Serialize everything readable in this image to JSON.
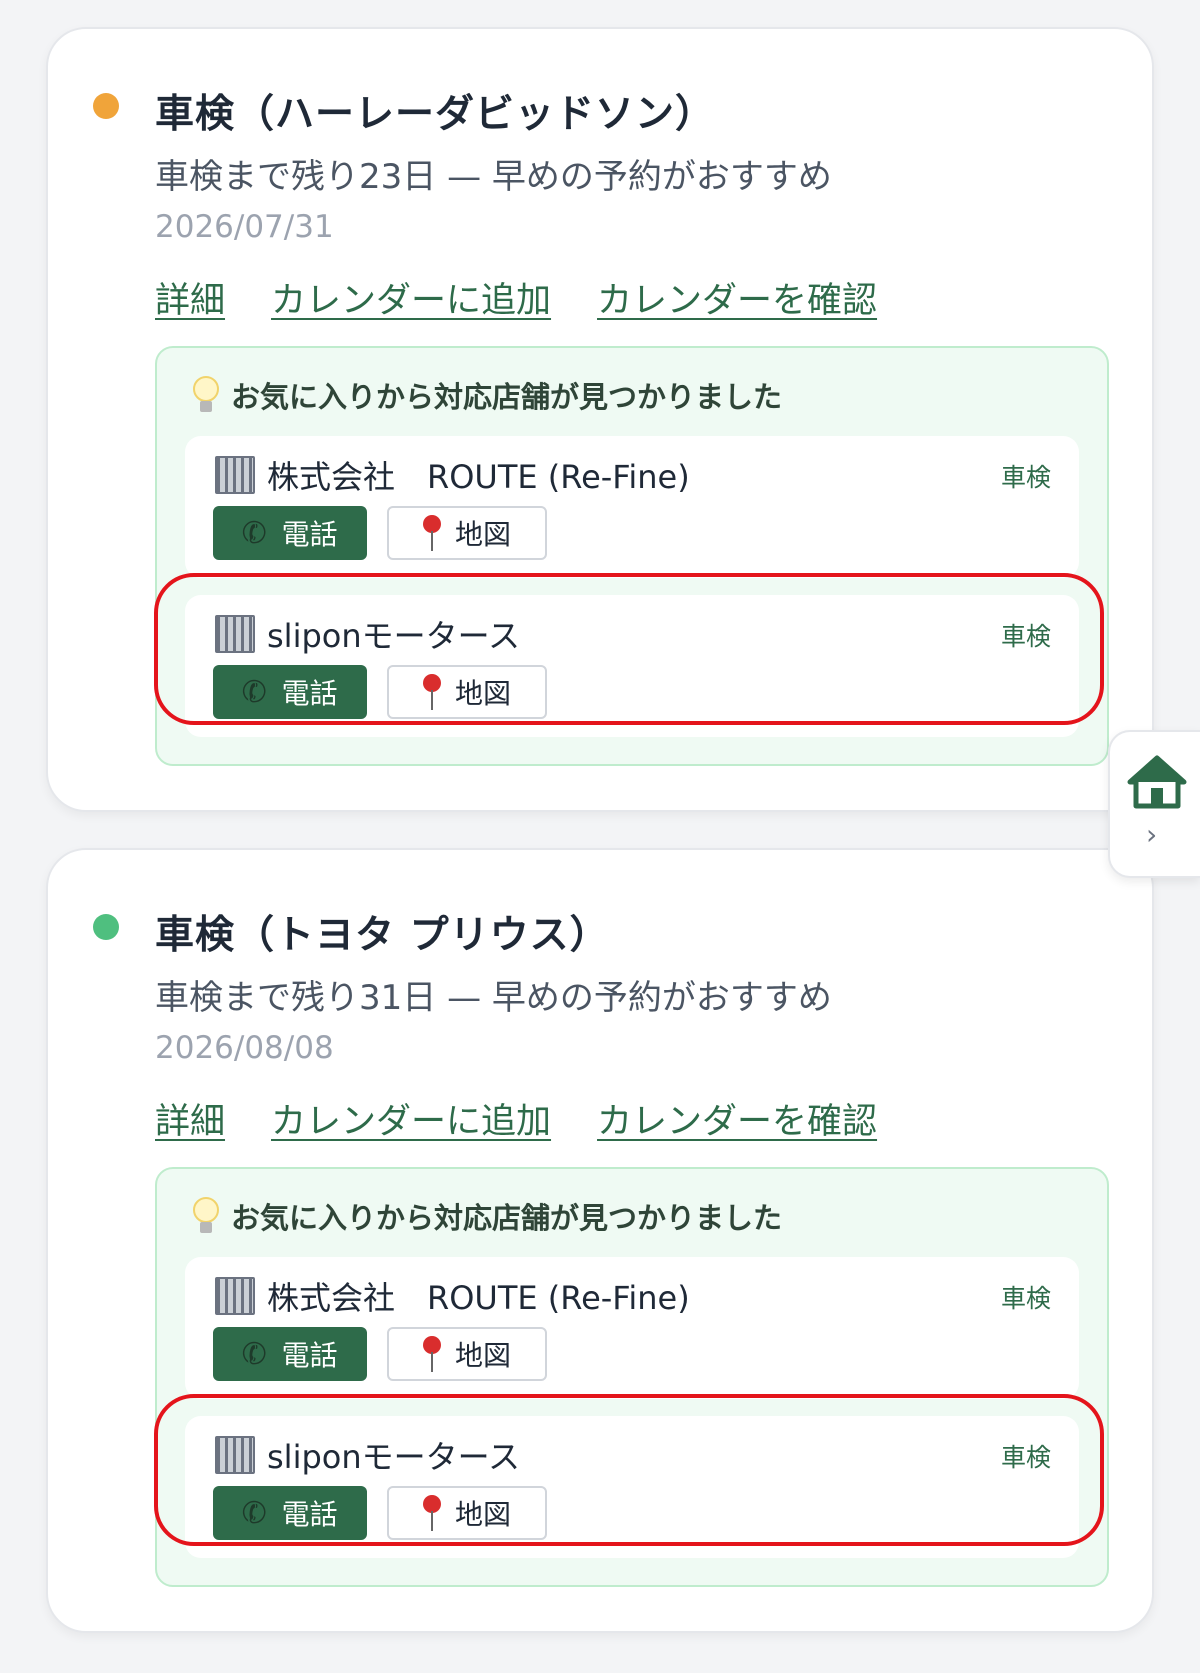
{
  "cards": [
    {
      "dot_color": "#f0a43a",
      "title": "車検（ハーレーダビッドソン）",
      "subtitle": "車検まで残り23日 — 早めの予約がおすすめ",
      "date": "2026/07/31",
      "links": [
        "詳細",
        "カレンダーに追加",
        "カレンダーを確認"
      ],
      "recommend_title": "お気に入りから対応店舗が見つかりました",
      "shops": [
        {
          "name": "株式会社　ROUTE (Re-Fine)",
          "tag": "車検",
          "tel_label": "電話",
          "map_label": "地図"
        },
        {
          "name": "sliponモータース",
          "tag": "車検",
          "tel_label": "電話",
          "map_label": "地図"
        }
      ]
    },
    {
      "dot_color": "#4fbf7f",
      "title": "車検（トヨタ プリウス）",
      "subtitle": "車検まで残り31日 — 早めの予約がおすすめ",
      "date": "2026/08/08",
      "links": [
        "詳細",
        "カレンダーに追加",
        "カレンダーを確認"
      ],
      "recommend_title": "お気に入りから対応店舗が見つかりました",
      "shops": [
        {
          "name": "株式会社　ROUTE (Re-Fine)",
          "tag": "車検",
          "tel_label": "電話",
          "map_label": "地図"
        },
        {
          "name": "sliponモータース",
          "tag": "車検",
          "tel_label": "電話",
          "map_label": "地図"
        }
      ]
    }
  ],
  "side_tab": {
    "icon": "house-icon",
    "chevron": "›"
  },
  "colors": {
    "accent": "#2e6b4a",
    "highlight": "#e4141b",
    "panel_bg": "#effaf3"
  }
}
